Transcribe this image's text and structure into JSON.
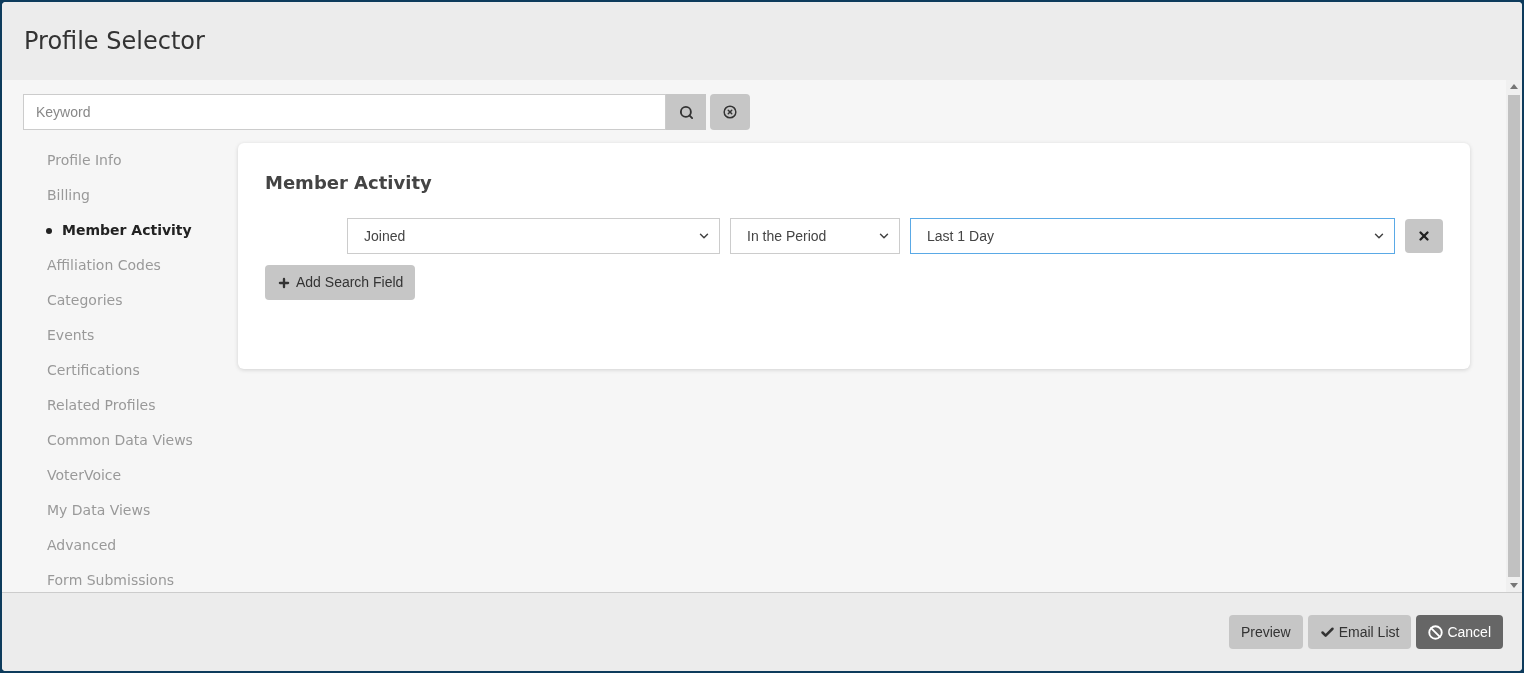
{
  "window": {
    "title": "Profile Selector"
  },
  "search": {
    "placeholder": "Keyword"
  },
  "sidebar": {
    "items": [
      {
        "label": "Profile Info",
        "selected": false
      },
      {
        "label": "Billing",
        "selected": false
      },
      {
        "label": "Member Activity",
        "selected": true
      },
      {
        "label": "Affiliation Codes",
        "selected": false
      },
      {
        "label": "Categories",
        "selected": false
      },
      {
        "label": "Events",
        "selected": false
      },
      {
        "label": "Certifications",
        "selected": false
      },
      {
        "label": "Related Profiles",
        "selected": false
      },
      {
        "label": "Common Data Views",
        "selected": false
      },
      {
        "label": "VoterVoice",
        "selected": false
      },
      {
        "label": "My Data Views",
        "selected": false
      },
      {
        "label": "Advanced",
        "selected": false
      },
      {
        "label": "Form Submissions",
        "selected": false
      }
    ]
  },
  "panel": {
    "title": "Member Activity",
    "filter_fields": [
      {
        "value": "Joined",
        "focused": false
      },
      {
        "value": "In the Period",
        "focused": false
      },
      {
        "value": "Last 1 Day",
        "focused": true
      }
    ],
    "add_button": "Add Search Field"
  },
  "footer": {
    "buttons": [
      {
        "label": "Preview",
        "kind": "plain"
      },
      {
        "label": "Email List",
        "kind": "check"
      },
      {
        "label": "Cancel",
        "kind": "cancel"
      }
    ]
  }
}
